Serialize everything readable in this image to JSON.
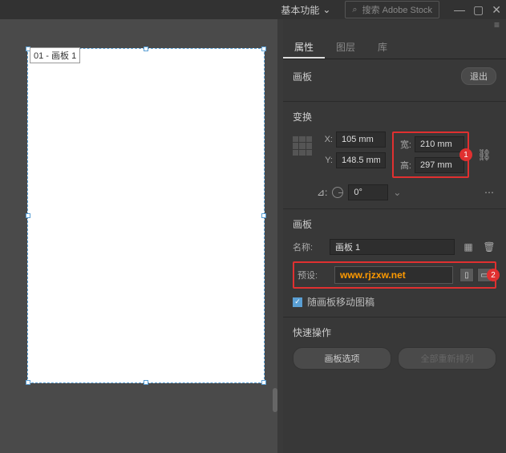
{
  "topbar": {
    "workspace_label": "基本功能",
    "search_placeholder": "搜索 Adobe Stock"
  },
  "canvas": {
    "artboard_label": "01 - 画板 1"
  },
  "panel": {
    "tabs": {
      "properties": "属性",
      "layers": "图层",
      "libraries": "库"
    },
    "artboard_section": {
      "title": "画板",
      "exit_label": "退出"
    },
    "transform": {
      "title": "变换",
      "x_label": "X:",
      "y_label": "Y:",
      "w_label": "宽:",
      "h_label": "高:",
      "x_value": "105 mm",
      "y_value": "148.5 mm",
      "w_value": "210 mm",
      "h_value": "297 mm",
      "angle_label": "⊿:",
      "angle_value": "0°",
      "highlight_badge": "1"
    },
    "artboard_detail": {
      "title": "画板",
      "name_label": "名称:",
      "name_value": "画板 1",
      "preset_label": "预设:",
      "preset_value": "www.rjzxw.net",
      "move_artwork_label": "随画板移动图稿",
      "move_artwork_checked": true,
      "highlight_badge": "2"
    },
    "quick_actions": {
      "title": "快速操作",
      "options_label": "画板选项",
      "rearrange_label": "全部重新排列"
    }
  },
  "chart_data": null
}
